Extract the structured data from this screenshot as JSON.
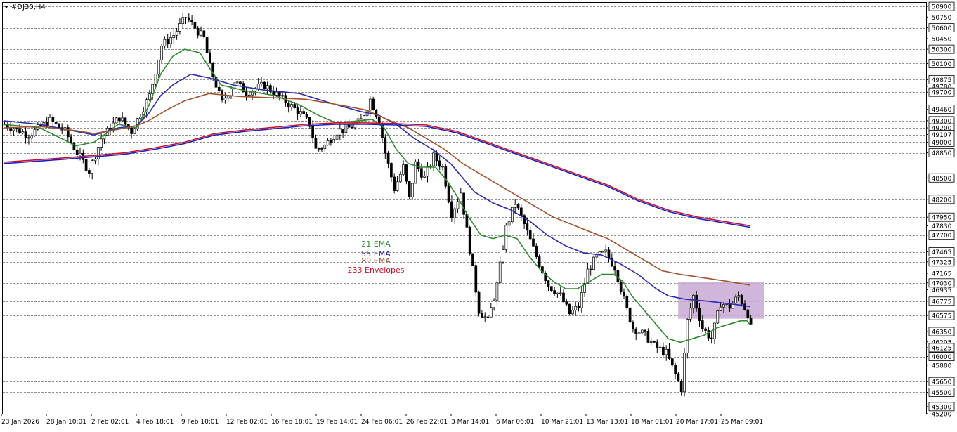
{
  "window": {
    "symbol_label": "#DJ30,H4"
  },
  "legend": [
    {
      "text": "21 EMA",
      "color": "#2e8b2e"
    },
    {
      "text": "55 EMA",
      "color": "#2b2bb0"
    },
    {
      "text": "89 EMA",
      "color": "#a0522d"
    },
    {
      "text": "233 Envelopes",
      "color": "#c8102e"
    }
  ],
  "chart_data": {
    "type": "candlestick",
    "title": "",
    "timeframe": "H4",
    "ylim": [
      45200,
      50950
    ],
    "grid": "horizontal dashed at level lines",
    "y_tick_labels": [
      50900,
      50750,
      50600,
      50450,
      50300,
      50100,
      49875,
      49780,
      49700,
      49460,
      49300,
      49200,
      49107,
      49000,
      48850,
      48500,
      48200,
      47950,
      47830,
      47700,
      47465,
      47325,
      47165,
      47030,
      46935,
      46775,
      46575,
      46350,
      46205,
      46125,
      46000,
      45880,
      45650,
      45500,
      45300,
      45200
    ],
    "dashed_level_lines": [
      50900,
      50600,
      50300,
      50100,
      49875,
      49700,
      49460,
      49300,
      49200,
      49107,
      49000,
      48850,
      48500,
      48200,
      47950,
      47700,
      47465,
      47325,
      47030,
      46775,
      46575,
      46350,
      46125,
      46000,
      45650,
      45500,
      45300
    ],
    "x_tick_labels": [
      "23 Jan 2026",
      "28 Jan 10:01",
      "2 Feb 02:01",
      "4 Feb 18:01",
      "9 Feb 10:01",
      "12 Feb 02:01",
      "16 Feb 18:01",
      "19 Feb 14:01",
      "24 Feb 06:01",
      "26 Feb 22:01",
      "3 Mar 14:01",
      "6 Mar 06:01",
      "10 Mar 21:01",
      "13 Mar 13:01",
      "18 Mar 01:01",
      "20 Mar 17:01",
      "25 Mar 09:01"
    ],
    "price_path_anchors": [
      [
        0,
        49250
      ],
      [
        8,
        49100
      ],
      [
        15,
        49300
      ],
      [
        20,
        49150
      ],
      [
        24,
        48850
      ],
      [
        28,
        48600
      ],
      [
        32,
        49050
      ],
      [
        38,
        49350
      ],
      [
        42,
        49150
      ],
      [
        45,
        49400
      ],
      [
        48,
        49650
      ],
      [
        52,
        50350
      ],
      [
        56,
        50500
      ],
      [
        60,
        50750
      ],
      [
        63,
        50600
      ],
      [
        66,
        50450
      ],
      [
        68,
        50050
      ],
      [
        72,
        49550
      ],
      [
        76,
        49850
      ],
      [
        80,
        49700
      ],
      [
        86,
        49800
      ],
      [
        92,
        49600
      ],
      [
        98,
        49400
      ],
      [
        101,
        49250
      ],
      [
        103,
        48900
      ],
      [
        106,
        48950
      ],
      [
        110,
        49150
      ],
      [
        114,
        49200
      ],
      [
        118,
        49300
      ],
      [
        121,
        49600
      ],
      [
        124,
        49300
      ],
      [
        126,
        48850
      ],
      [
        129,
        48350
      ],
      [
        132,
        48650
      ],
      [
        134,
        48200
      ],
      [
        136,
        48700
      ],
      [
        139,
        48500
      ],
      [
        142,
        48800
      ],
      [
        145,
        48650
      ],
      [
        148,
        48000
      ],
      [
        151,
        48300
      ],
      [
        154,
        47500
      ],
      [
        157,
        46650
      ],
      [
        160,
        46500
      ],
      [
        163,
        47000
      ],
      [
        166,
        47800
      ],
      [
        169,
        48150
      ],
      [
        172,
        47850
      ],
      [
        176,
        47400
      ],
      [
        180,
        47000
      ],
      [
        184,
        46850
      ],
      [
        187,
        46600
      ],
      [
        190,
        46700
      ],
      [
        193,
        47200
      ],
      [
        196,
        47400
      ],
      [
        199,
        47450
      ],
      [
        202,
        47250
      ],
      [
        204,
        46950
      ],
      [
        206,
        46650
      ],
      [
        208,
        46400
      ],
      [
        212,
        46300
      ],
      [
        215,
        46150
      ],
      [
        219,
        46050
      ],
      [
        222,
        45750
      ],
      [
        224,
        45550
      ],
      [
        226,
        46500
      ],
      [
        228,
        46850
      ],
      [
        231,
        46400
      ],
      [
        234,
        46250
      ],
      [
        237,
        46750
      ],
      [
        240,
        46700
      ],
      [
        243,
        46850
      ],
      [
        246,
        46600
      ],
      [
        247,
        46400
      ]
    ],
    "series": [
      {
        "name": "21 EMA",
        "color": "#2e8b2e",
        "points": [
          [
            0,
            49250
          ],
          [
            12,
            49200
          ],
          [
            24,
            48950
          ],
          [
            30,
            49000
          ],
          [
            38,
            49250
          ],
          [
            44,
            49200
          ],
          [
            48,
            49500
          ],
          [
            52,
            49950
          ],
          [
            56,
            50200
          ],
          [
            60,
            50300
          ],
          [
            65,
            50250
          ],
          [
            68,
            50050
          ],
          [
            72,
            49800
          ],
          [
            80,
            49720
          ],
          [
            90,
            49650
          ],
          [
            98,
            49520
          ],
          [
            104,
            49380
          ],
          [
            110,
            49270
          ],
          [
            118,
            49300
          ],
          [
            122,
            49320
          ],
          [
            126,
            49200
          ],
          [
            130,
            48900
          ],
          [
            134,
            48700
          ],
          [
            138,
            48650
          ],
          [
            143,
            48650
          ],
          [
            147,
            48450
          ],
          [
            150,
            48250
          ],
          [
            154,
            47950
          ],
          [
            158,
            47700
          ],
          [
            162,
            47650
          ],
          [
            166,
            47700
          ],
          [
            170,
            47650
          ],
          [
            174,
            47400
          ],
          [
            178,
            47200
          ],
          [
            182,
            47050
          ],
          [
            186,
            46950
          ],
          [
            190,
            46950
          ],
          [
            194,
            47050
          ],
          [
            198,
            47150
          ],
          [
            202,
            47150
          ],
          [
            205,
            47050
          ],
          [
            208,
            46850
          ],
          [
            212,
            46650
          ],
          [
            216,
            46450
          ],
          [
            220,
            46250
          ],
          [
            224,
            46200
          ],
          [
            228,
            46250
          ],
          [
            232,
            46300
          ],
          [
            236,
            46400
          ],
          [
            240,
            46450
          ],
          [
            244,
            46500
          ],
          [
            246,
            46500
          ],
          [
            247,
            46450
          ]
        ]
      },
      {
        "name": "55 EMA",
        "color": "#2b2bb0",
        "points": [
          [
            0,
            49300
          ],
          [
            12,
            49250
          ],
          [
            24,
            49150
          ],
          [
            30,
            49100
          ],
          [
            38,
            49200
          ],
          [
            44,
            49230
          ],
          [
            48,
            49400
          ],
          [
            52,
            49650
          ],
          [
            56,
            49800
          ],
          [
            62,
            49950
          ],
          [
            68,
            49900
          ],
          [
            76,
            49800
          ],
          [
            86,
            49730
          ],
          [
            98,
            49680
          ],
          [
            108,
            49550
          ],
          [
            118,
            49430
          ],
          [
            124,
            49380
          ],
          [
            130,
            49250
          ],
          [
            136,
            49050
          ],
          [
            142,
            48900
          ],
          [
            148,
            48700
          ],
          [
            152,
            48500
          ],
          [
            156,
            48300
          ],
          [
            162,
            48150
          ],
          [
            168,
            48050
          ],
          [
            174,
            47900
          ],
          [
            180,
            47700
          ],
          [
            186,
            47550
          ],
          [
            192,
            47450
          ],
          [
            198,
            47420
          ],
          [
            204,
            47300
          ],
          [
            210,
            47150
          ],
          [
            216,
            46950
          ],
          [
            220,
            46850
          ],
          [
            226,
            46800
          ],
          [
            232,
            46780
          ],
          [
            238,
            46750
          ],
          [
            244,
            46720
          ],
          [
            247,
            46700
          ]
        ]
      },
      {
        "name": "89 EMA",
        "color": "#a0522d",
        "points": [
          [
            0,
            49200
          ],
          [
            12,
            49220
          ],
          [
            24,
            49160
          ],
          [
            30,
            49120
          ],
          [
            38,
            49180
          ],
          [
            44,
            49230
          ],
          [
            48,
            49300
          ],
          [
            54,
            49450
          ],
          [
            60,
            49580
          ],
          [
            68,
            49680
          ],
          [
            78,
            49640
          ],
          [
            90,
            49620
          ],
          [
            100,
            49600
          ],
          [
            110,
            49530
          ],
          [
            120,
            49450
          ],
          [
            128,
            49300
          ],
          [
            134,
            49200
          ],
          [
            140,
            49050
          ],
          [
            146,
            48900
          ],
          [
            152,
            48700
          ],
          [
            158,
            48550
          ],
          [
            164,
            48400
          ],
          [
            170,
            48250
          ],
          [
            176,
            48100
          ],
          [
            182,
            47950
          ],
          [
            188,
            47850
          ],
          [
            194,
            47750
          ],
          [
            200,
            47650
          ],
          [
            206,
            47500
          ],
          [
            212,
            47350
          ],
          [
            218,
            47200
          ],
          [
            224,
            47150
          ],
          [
            232,
            47100
          ],
          [
            240,
            47050
          ],
          [
            247,
            47000
          ]
        ]
      },
      {
        "name": "233 Envelopes (upper)",
        "color": "#c8102e",
        "points": [
          [
            0,
            48720
          ],
          [
            20,
            48780
          ],
          [
            40,
            48850
          ],
          [
            50,
            48920
          ],
          [
            60,
            49000
          ],
          [
            70,
            49120
          ],
          [
            80,
            49170
          ],
          [
            90,
            49210
          ],
          [
            100,
            49250
          ],
          [
            110,
            49270
          ],
          [
            120,
            49270
          ],
          [
            130,
            49260
          ],
          [
            140,
            49240
          ],
          [
            150,
            49150
          ],
          [
            160,
            49000
          ],
          [
            170,
            48850
          ],
          [
            180,
            48700
          ],
          [
            190,
            48550
          ],
          [
            200,
            48400
          ],
          [
            210,
            48200
          ],
          [
            220,
            48050
          ],
          [
            230,
            47950
          ],
          [
            240,
            47880
          ],
          [
            247,
            47830
          ]
        ]
      },
      {
        "name": "233 Envelopes (lower)",
        "color": "#2020c0",
        "points": [
          [
            0,
            48700
          ],
          [
            20,
            48760
          ],
          [
            40,
            48830
          ],
          [
            50,
            48900
          ],
          [
            60,
            48980
          ],
          [
            70,
            49100
          ],
          [
            80,
            49150
          ],
          [
            90,
            49190
          ],
          [
            100,
            49230
          ],
          [
            110,
            49250
          ],
          [
            120,
            49250
          ],
          [
            130,
            49240
          ],
          [
            140,
            49220
          ],
          [
            150,
            49130
          ],
          [
            160,
            48980
          ],
          [
            170,
            48830
          ],
          [
            180,
            48680
          ],
          [
            190,
            48530
          ],
          [
            200,
            48380
          ],
          [
            210,
            48180
          ],
          [
            220,
            48030
          ],
          [
            230,
            47930
          ],
          [
            240,
            47860
          ],
          [
            247,
            47810
          ]
        ]
      }
    ],
    "highlight_zone": {
      "x_range": [
        224,
        247
      ],
      "y_range": [
        46530,
        47040
      ],
      "color": "#c9a9d6"
    }
  }
}
